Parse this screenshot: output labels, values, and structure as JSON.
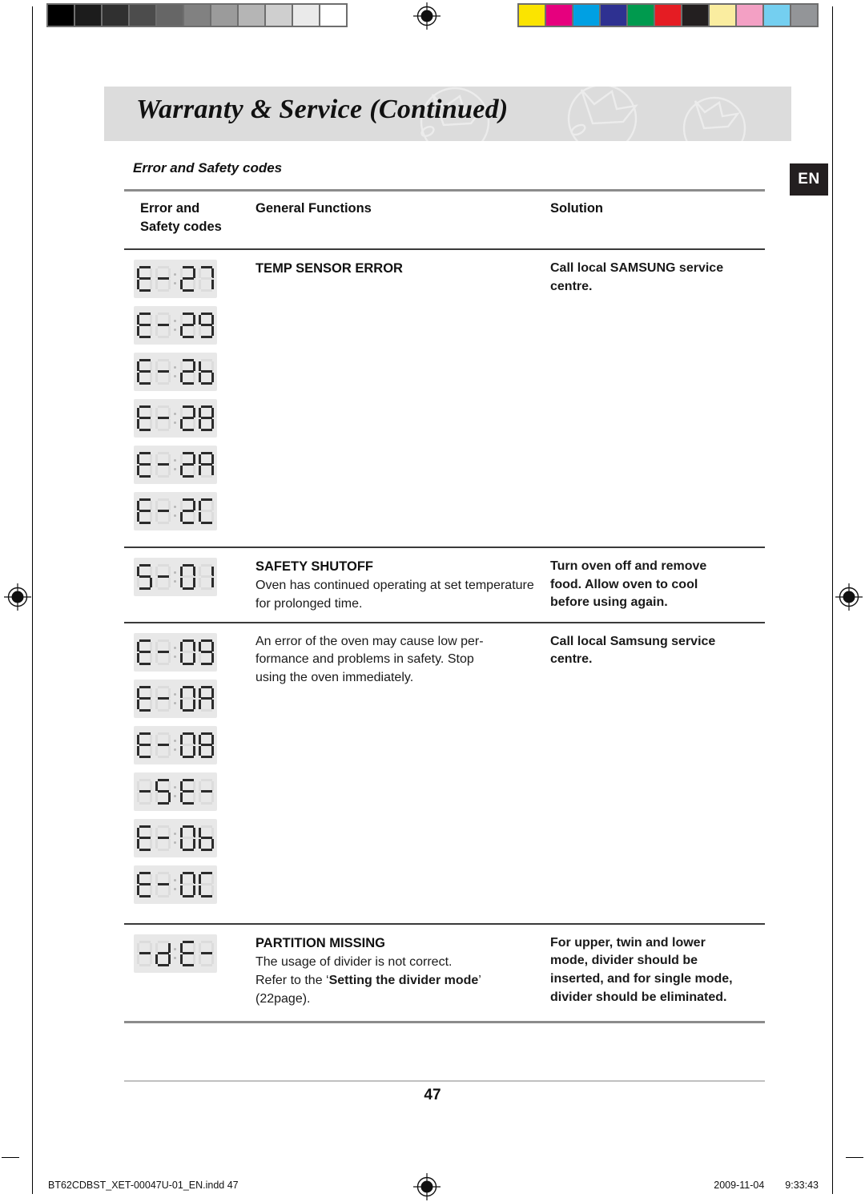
{
  "print_strip": {
    "grayscale_patches": [
      "#000000",
      "#1c1c1c",
      "#303030",
      "#4c4c4c",
      "#666666",
      "#818181",
      "#9b9b9b",
      "#b5b5b5",
      "#cfcfcf",
      "#eaeaea",
      "#ffffff"
    ],
    "color_patches": [
      "#fbe400",
      "#e6007e",
      "#00a0e3",
      "#2e3191",
      "#009a4e",
      "#e51c23",
      "#231f20",
      "#faeda0",
      "#f3a0c4",
      "#74cff0",
      "#939598"
    ],
    "registration_icon": "registration-target-icon"
  },
  "header": {
    "title": "Warranty & Service (Continued)",
    "language_tab": "EN",
    "band_color": "#dcdcdc"
  },
  "section": {
    "subtitle": "Error and Safety codes"
  },
  "table": {
    "columns": {
      "code": "Error and\nSafety codes",
      "code_line1": "Error and",
      "code_line2": "Safety codes",
      "functions": "General Functions",
      "solution": "Solution"
    },
    "rows": [
      {
        "codes": [
          "E-27",
          "E-29",
          "E-2b",
          "E-28",
          "E-2A",
          "E-2C"
        ],
        "function_heading": "TEMP SENSOR ERROR",
        "function_body": "",
        "solution_lines": [
          "Call local SAMSUNG service",
          "centre."
        ],
        "solution_bold": true
      },
      {
        "codes": [
          "S-01"
        ],
        "function_heading": "SAFETY SHUTOFF",
        "function_body": "Oven has continued operating at set temperature for prolonged time.",
        "solution_lines": [
          "Turn oven off and remove",
          "food. Allow oven to cool",
          "before using again."
        ],
        "solution_bold": true
      },
      {
        "codes": [
          "E-09",
          "E-0A",
          "E-08",
          "-SE-",
          "E-0b",
          "E-0C"
        ],
        "function_heading": "",
        "function_body": "An error of the oven may cause low per-formance and problems in safety. Stop using the oven immediately.",
        "function_body_lines": [
          "An error of the oven may cause low per-",
          "formance and problems in safety. Stop",
          "using the oven immediately."
        ],
        "solution_lines": [
          "Call local Samsung service",
          "centre."
        ],
        "solution_bold": true
      },
      {
        "codes": [
          "-dE-"
        ],
        "function_heading": "PARTITION MISSING",
        "function_body_lines": [
          "The usage of divider is not correct.",
          "Refer to the ‘Setting the divider mode’",
          "(22page)."
        ],
        "function_body_emphasis": "Setting the divider mode",
        "solution_lines": [
          "For upper, twin and lower",
          "mode, divider should be",
          "inserted, and for single mode,",
          "divider should be eliminated."
        ],
        "solution_bold": true
      }
    ]
  },
  "footer": {
    "page_number": "47",
    "file_name": "BT62CDBST_XET-00047U-01_EN.indd   47",
    "date": "2009-11-04",
    "time": "9:33:43"
  }
}
